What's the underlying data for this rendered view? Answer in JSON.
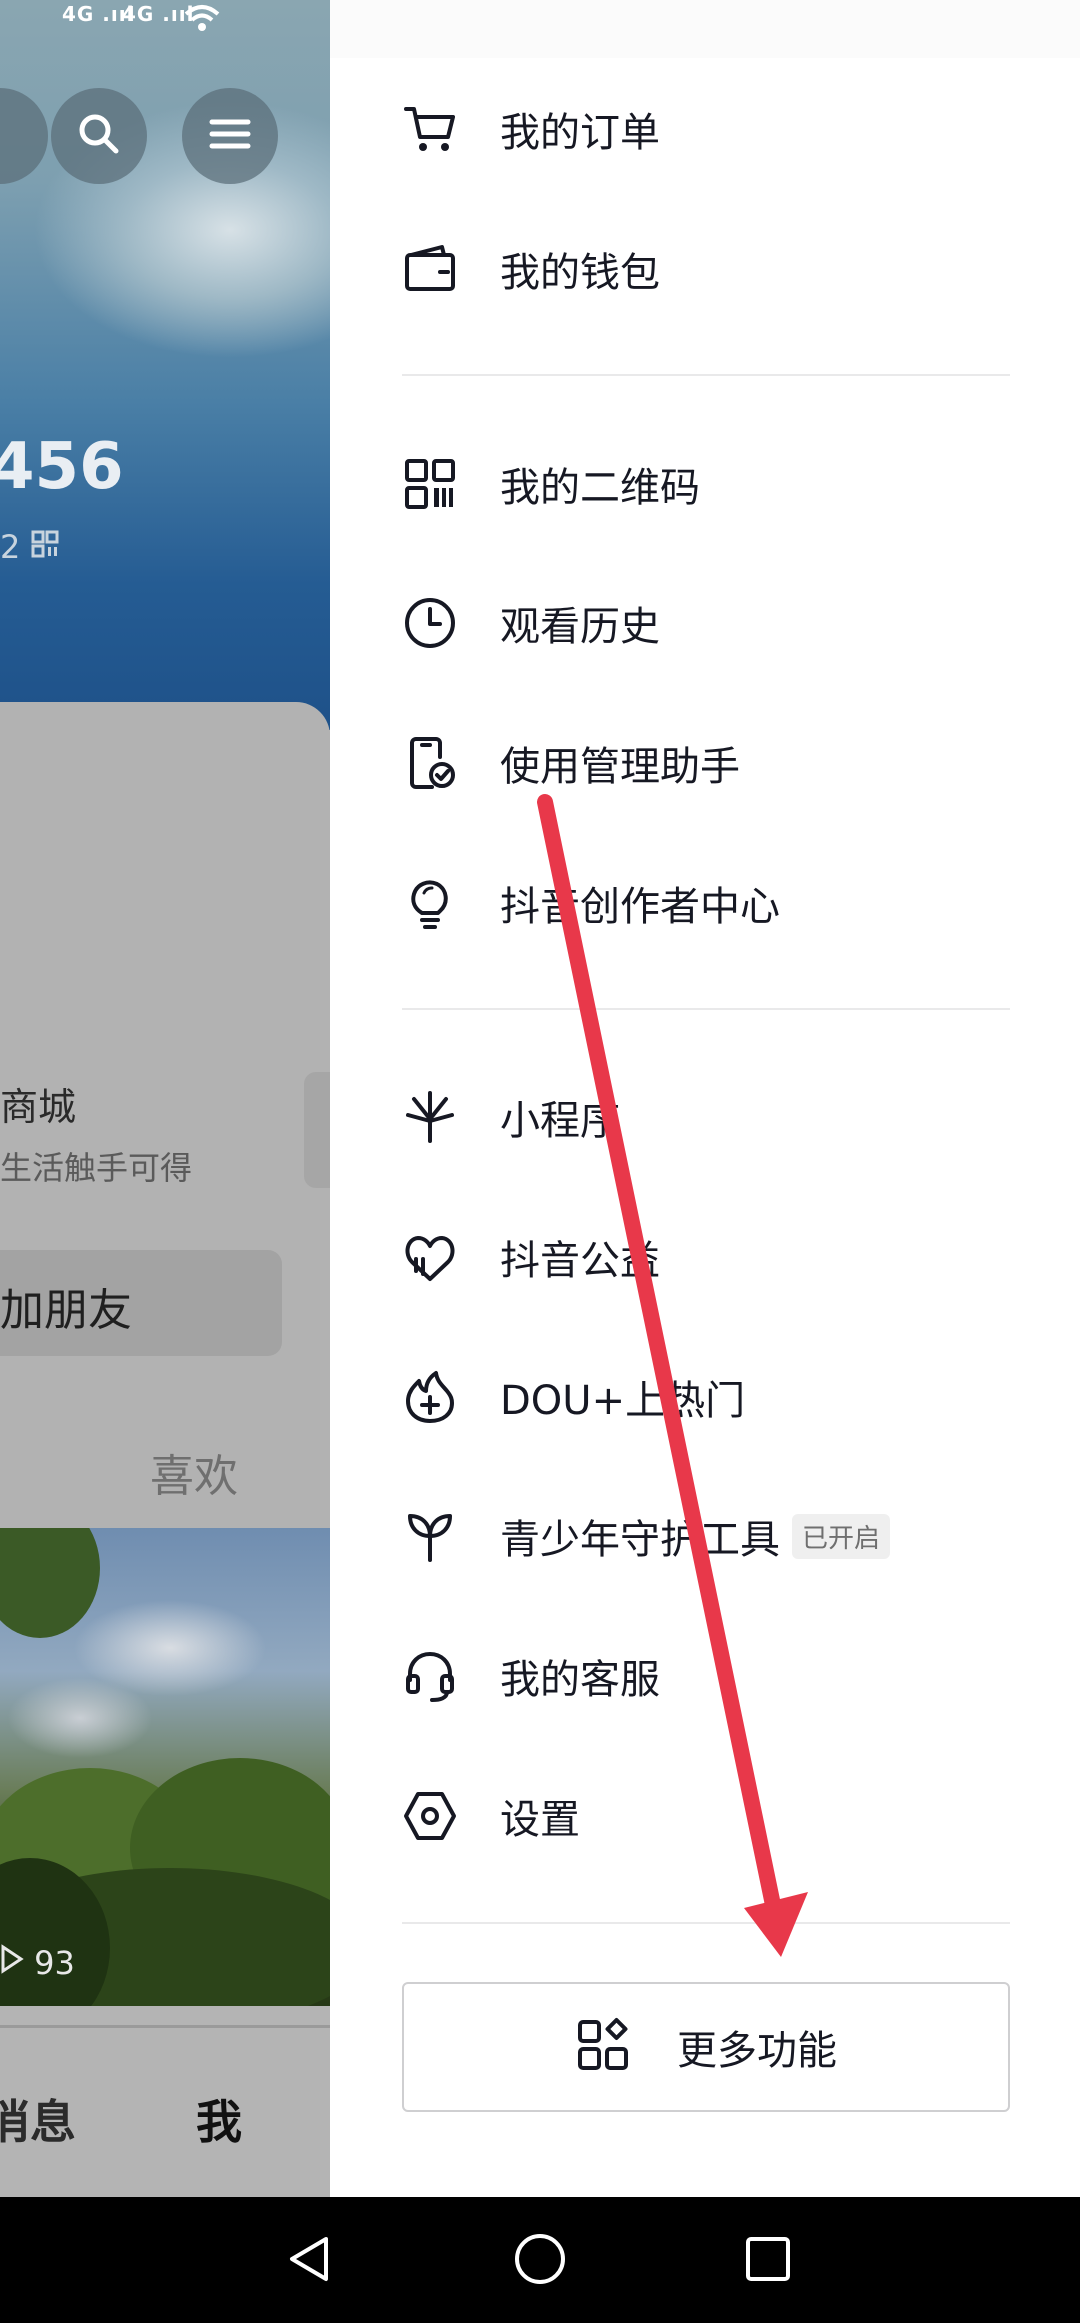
{
  "background": {
    "status_signal_1": "4G .ııl",
    "status_signal_2": "4G .ııl",
    "count_text": "456",
    "sub_text": "2",
    "shop_title": "商城",
    "shop_subtitle": "生活触手可得",
    "add_friend_label": "加朋友",
    "like_tab_label": "喜欢",
    "video_views": "93",
    "nav_message": "消息",
    "nav_me": "我"
  },
  "drawer": {
    "group1": [
      {
        "label": "我的订单",
        "icon": "cart-icon"
      },
      {
        "label": "我的钱包",
        "icon": "wallet-icon"
      }
    ],
    "group2": [
      {
        "label": "我的二维码",
        "icon": "qrcode-icon"
      },
      {
        "label": "观看历史",
        "icon": "clock-icon"
      },
      {
        "label": "使用管理助手",
        "icon": "phone-check-icon"
      },
      {
        "label": "抖音创作者中心",
        "icon": "lightbulb-icon"
      }
    ],
    "group3": [
      {
        "label": "小程序",
        "icon": "mini-program-icon"
      },
      {
        "label": "抖音公益",
        "icon": "heart-hands-icon"
      },
      {
        "label": "DOU+上热门",
        "icon": "flame-plus-icon"
      },
      {
        "label": "青少年守护工具",
        "icon": "sprout-icon",
        "badge": "已开启"
      },
      {
        "label": "我的客服",
        "icon": "headset-icon"
      },
      {
        "label": "设置",
        "icon": "hexagon-settings-icon"
      }
    ],
    "more_button": {
      "label": "更多功能",
      "icon": "grid-apps-icon"
    }
  },
  "system_nav": {
    "back": "back-triangle-icon",
    "home": "home-circle-icon",
    "recents": "recents-square-icon"
  },
  "colors": {
    "text_primary": "#161823",
    "divider": "#e9e9ea",
    "arrow": "#e8384a",
    "badge_bg": "#efefef"
  }
}
